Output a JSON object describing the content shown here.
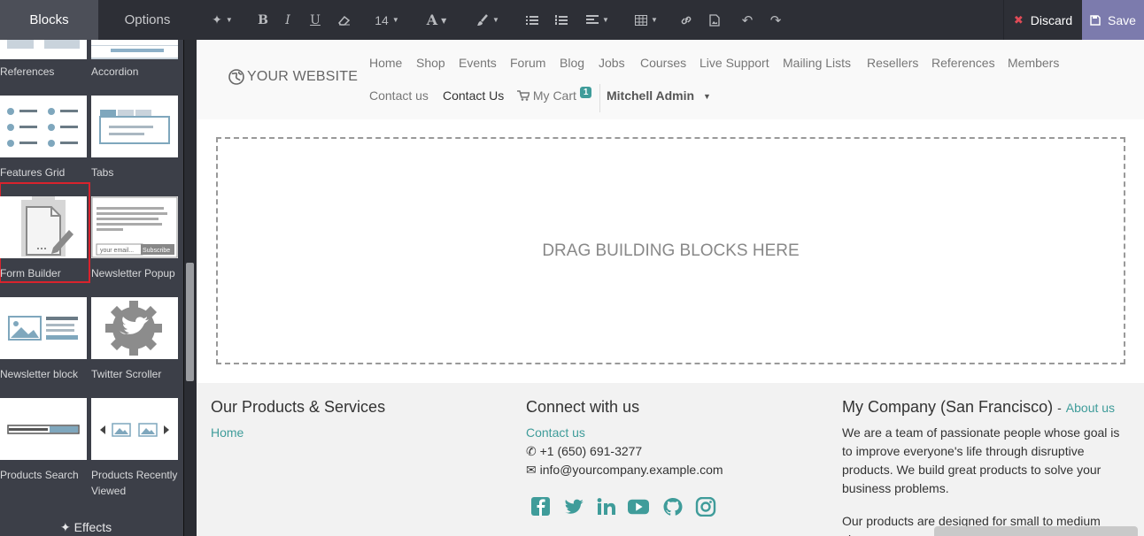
{
  "sidebar": {
    "tabs": [
      "Blocks",
      "Options"
    ],
    "blocks": [
      {
        "label": "References"
      },
      {
        "label": "Accordion"
      },
      {
        "label": "Features Grid"
      },
      {
        "label": "Tabs"
      },
      {
        "label": "Form Builder"
      },
      {
        "label": "Newsletter Popup"
      },
      {
        "label": "Newsletter block"
      },
      {
        "label": "Twitter Scroller"
      },
      {
        "label": "Products Search"
      },
      {
        "label": "Products Recently Viewed"
      }
    ],
    "newsletter_popup_placeholder": "your email...",
    "newsletter_popup_button": "Subscribe",
    "effects_label": "Effects"
  },
  "toolbar": {
    "font_size": "14",
    "discard_label": "Discard",
    "save_label": "Save",
    "save_color": "#7c7bad"
  },
  "site": {
    "logo_text": "YOUR WEBSITE",
    "nav": [
      "Home",
      "Shop",
      "Events",
      "Forum",
      "Blog",
      "Jobs",
      "Courses",
      "Live Support",
      "Mailing Lists",
      "Resellers",
      "References",
      "Members"
    ],
    "nav_row2": {
      "contact_us": "Contact us",
      "contact_us_active": "Contact Us",
      "cart_label": "My Cart",
      "cart_count": "1",
      "user": "Mitchell Admin"
    },
    "drop_zone_text": "DRAG BUILDING BLOCKS HERE"
  },
  "footer": {
    "col1": {
      "title": "Our Products & Services",
      "link": "Home"
    },
    "col2": {
      "title": "Connect with us",
      "link": "Contact us",
      "phone": "+1 (650) 691-3277",
      "email": "info@yourcompany.example.com"
    },
    "col3": {
      "title": "My Company (San Francisco)",
      "separator": "-",
      "about_link": "About us",
      "para1": "We are a team of passionate people whose goal is to improve everyone's life through disruptive products. We build great products to solve your business problems.",
      "para2": "Our products are designed for small to medium size"
    },
    "social_icons": [
      "facebook-icon",
      "twitter-icon",
      "linkedin-icon",
      "youtube-icon",
      "github-icon",
      "instagram-icon"
    ],
    "accent": "#3f9c9a"
  }
}
